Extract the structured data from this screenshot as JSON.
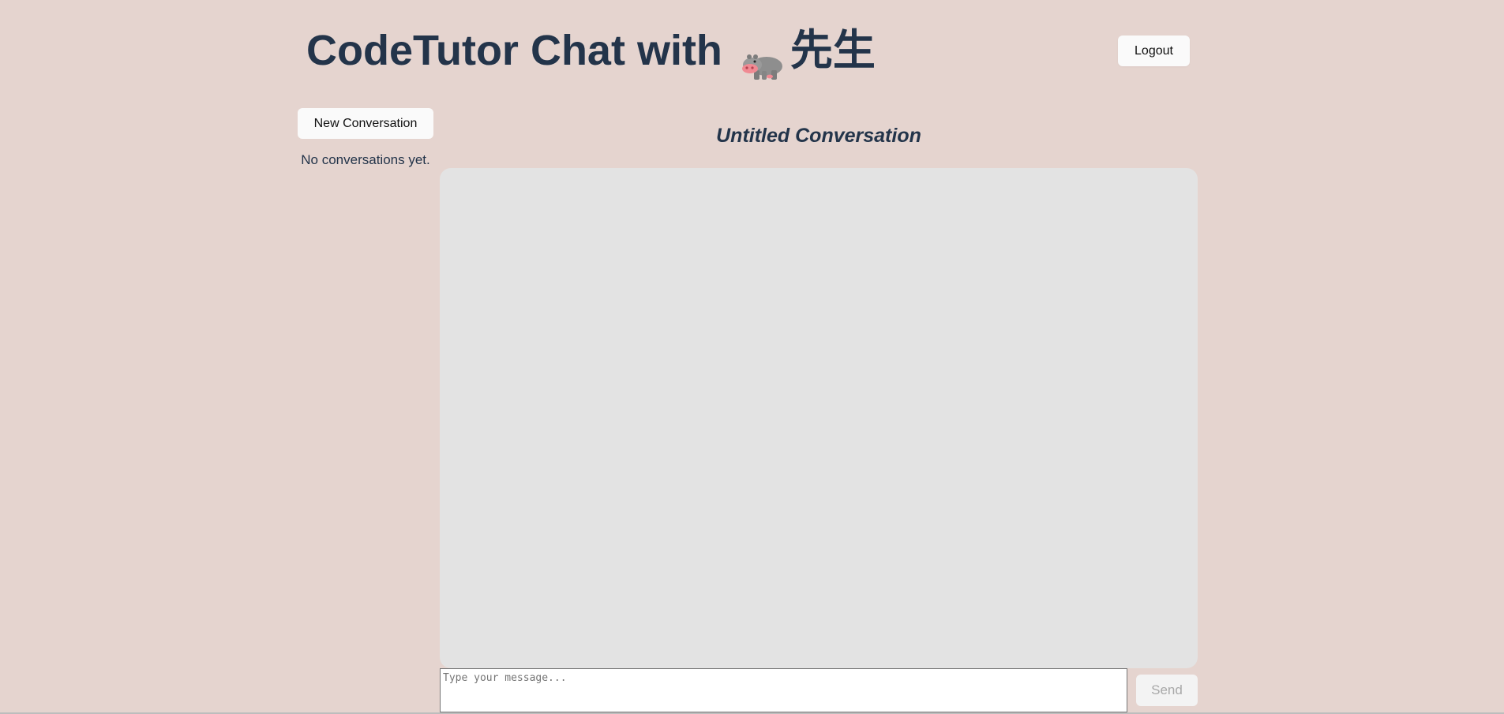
{
  "header": {
    "title": "CodeTutor Chat with",
    "title_icon": "hippo-icon",
    "title_suffix": "先生",
    "logout_label": "Logout"
  },
  "sidebar": {
    "new_conversation_label": "New Conversation",
    "empty_text": "No conversations yet."
  },
  "main": {
    "conversation_title": "Untitled Conversation",
    "messages": [],
    "input_placeholder": "Type your message...",
    "input_value": "",
    "send_label": "Send",
    "send_disabled": true
  },
  "colors": {
    "page_background": "#e5d4cf",
    "title_text": "#23344a",
    "message_area_background": "#e3e3e3",
    "button_background": "#fafafa",
    "send_disabled_text": "#a8a8a8"
  }
}
